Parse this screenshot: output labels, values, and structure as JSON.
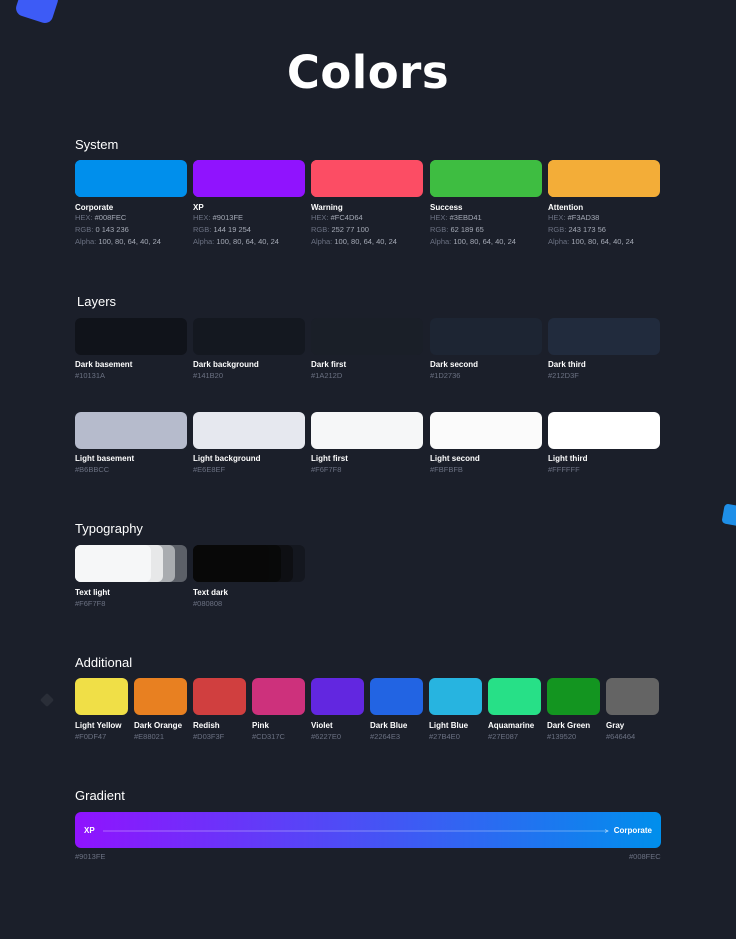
{
  "title": "Colors",
  "sections": {
    "system": "System",
    "layers": "Layers",
    "typography": "Typography",
    "additional": "Additional",
    "gradient": "Gradient"
  },
  "system": [
    {
      "name": "Corporate",
      "hex_label": "HEX:",
      "hex": "#008FEC",
      "rgb_label": "RGB:",
      "rgb": "0 143 236",
      "alpha_label": "Alpha:",
      "alpha": "100, 80, 64, 40, 24",
      "color": "#008FEC"
    },
    {
      "name": "XP",
      "hex_label": "HEX:",
      "hex": "#9013FE",
      "rgb_label": "RGB:",
      "rgb": "144 19 254",
      "alpha_label": "Alpha:",
      "alpha": "100, 80, 64, 40, 24",
      "color": "#9013FE"
    },
    {
      "name": "Warning",
      "hex_label": "HEX:",
      "hex": "#FC4D64",
      "rgb_label": "RGB:",
      "rgb": "252 77 100",
      "alpha_label": "Alpha:",
      "alpha": "100, 80, 64, 40, 24",
      "color": "#FC4D64"
    },
    {
      "name": "Success",
      "hex_label": "HEX:",
      "hex": "#3EBD41",
      "rgb_label": "RGB:",
      "rgb": "62 189 65",
      "alpha_label": "Alpha:",
      "alpha": "100, 80, 64, 40, 24",
      "color": "#3EBD41"
    },
    {
      "name": "Attention",
      "hex_label": "HEX:",
      "hex": "#F3AD38",
      "rgb_label": "RGB:",
      "rgb": "243 173 56",
      "alpha_label": "Alpha:",
      "alpha": "100, 80, 64, 40, 24",
      "color": "#F3AD38"
    }
  ],
  "layers_dark": [
    {
      "name": "Dark basement",
      "hex": "#10131A",
      "color": "#10131A"
    },
    {
      "name": "Dark background",
      "hex": "#141B20",
      "color": "#141820"
    },
    {
      "name": "Dark first",
      "hex": "#1A212D",
      "color": "#1A1F28"
    },
    {
      "name": "Dark second",
      "hex": "#1D2736",
      "color": "#1D2533"
    },
    {
      "name": "Dark third",
      "hex": "#212D3F",
      "color": "#212B3D"
    }
  ],
  "layers_light": [
    {
      "name": "Light basement",
      "hex": "#B6BBCC",
      "color": "#B6BBCC"
    },
    {
      "name": "Light background",
      "hex": "#E6E8EF",
      "color": "#E6E8EF"
    },
    {
      "name": "Light first",
      "hex": "#F6F7F8",
      "color": "#F6F7F8"
    },
    {
      "name": "Light second",
      "hex": "#FBFBFB",
      "color": "#FBFBFB"
    },
    {
      "name": "Light third",
      "hex": "#FFFFFF",
      "color": "#FFFFFF"
    }
  ],
  "typography": [
    {
      "name": "Text light",
      "hex": "#F6F7F8",
      "color": "#F6F7F8"
    },
    {
      "name": "Text dark",
      "hex": "#080808",
      "color": "#080808"
    }
  ],
  "additional": [
    {
      "name": "Light Yellow",
      "hex": "#F0DF47",
      "color": "#F0DF47"
    },
    {
      "name": "Dark Orange",
      "hex": "#E88021",
      "color": "#E88021"
    },
    {
      "name": "Redish",
      "hex": "#D03F3F",
      "color": "#D03F3F"
    },
    {
      "name": "Pink",
      "hex": "#CD317C",
      "color": "#CD317C"
    },
    {
      "name": "Violet",
      "hex": "#6227E0",
      "color": "#6227E0"
    },
    {
      "name": "Dark Blue",
      "hex": "#2264E3",
      "color": "#2264E3"
    },
    {
      "name": "Light Blue",
      "hex": "#27B4E0",
      "color": "#27B4E0"
    },
    {
      "name": "Aquamarine",
      "hex": "#27E087",
      "color": "#27E087"
    },
    {
      "name": "Dark Green",
      "hex": "#139520",
      "color": "#139520"
    },
    {
      "name": "Gray",
      "hex": "#646464",
      "color": "#646464"
    }
  ],
  "gradient": {
    "left_label": "XP",
    "right_label": "Corporate",
    "left_hex": "#9013FE",
    "right_hex": "#008FEC"
  }
}
